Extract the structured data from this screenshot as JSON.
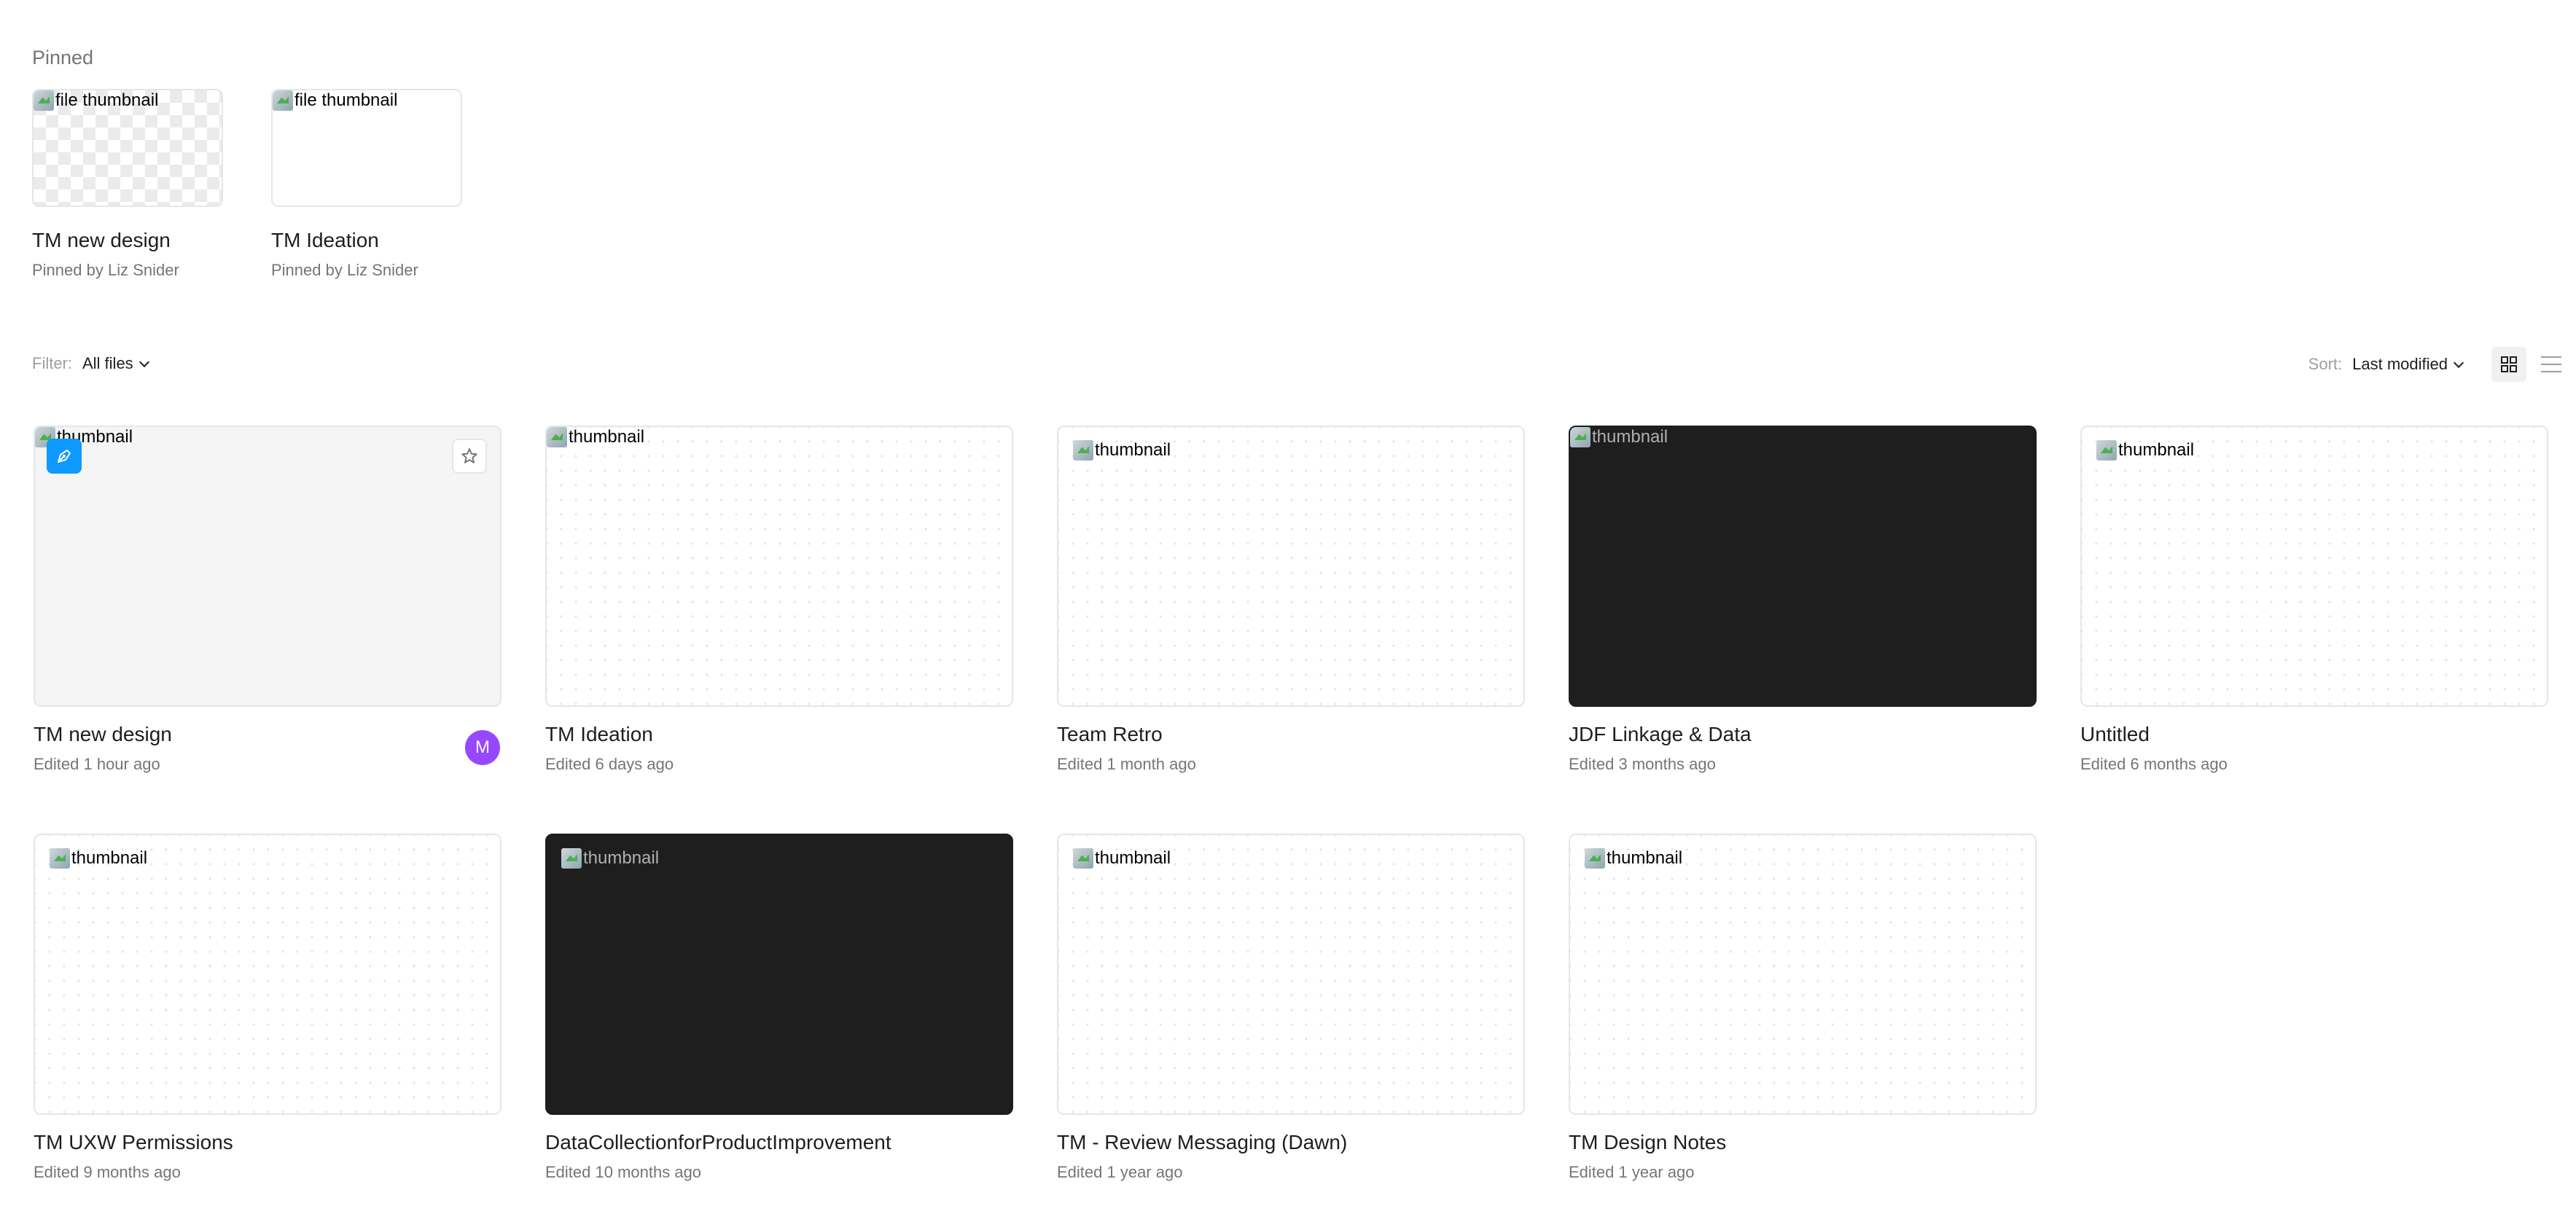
{
  "pinned": {
    "heading": "Pinned",
    "items": [
      {
        "name": "TM new design",
        "sub": "Pinned by Liz Snider",
        "alt": "file thumbnail"
      },
      {
        "name": "TM Ideation",
        "sub": "Pinned by Liz Snider",
        "alt": "file thumbnail"
      }
    ]
  },
  "filter": {
    "label": "Filter:",
    "value": "All files"
  },
  "sort": {
    "label": "Sort:",
    "value": "Last modified"
  },
  "files": [
    {
      "name": "TM new design",
      "edited": "Edited 1 hour ago",
      "alt": "thumbnail",
      "avatar": "M"
    },
    {
      "name": "TM Ideation",
      "edited": "Edited 6 days ago",
      "alt": "thumbnail"
    },
    {
      "name": "Team Retro",
      "edited": "Edited 1 month ago",
      "alt": "thumbnail"
    },
    {
      "name": "JDF Linkage & Data",
      "edited": "Edited 3 months ago",
      "alt": "thumbnail"
    },
    {
      "name": "Untitled",
      "edited": "Edited 6 months ago",
      "alt": "thumbnail"
    },
    {
      "name": "TM UXW Permissions",
      "edited": "Edited 9 months ago",
      "alt": "thumbnail"
    },
    {
      "name": "DataCollectionforProductImprovement",
      "edited": "Edited 10 months ago",
      "alt": "thumbnail"
    },
    {
      "name": "TM - Review Messaging (Dawn)",
      "edited": "Edited 1 year ago",
      "alt": "thumbnail"
    },
    {
      "name": "TM Design Notes",
      "edited": "Edited 1 year ago",
      "alt": "thumbnail"
    }
  ],
  "colors": {
    "accent": "#0d99ff",
    "avatar": "#9747ff",
    "dark_thumb": "#1e1e1e"
  },
  "icons": {
    "draw_badge": "pen-icon",
    "star": "star-icon",
    "grid_view": "grid-view-icon",
    "list_view": "list-view-icon"
  }
}
